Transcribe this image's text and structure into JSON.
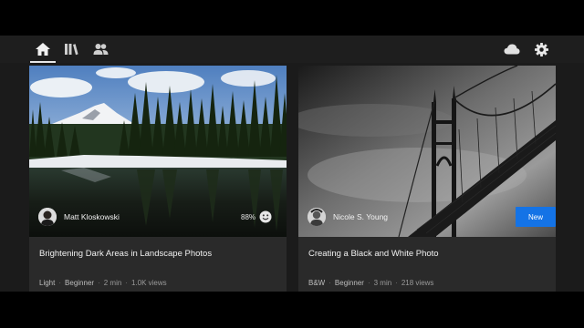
{
  "nav": {
    "items": [
      {
        "name": "home-icon",
        "active": true
      },
      {
        "name": "library-icon",
        "active": false
      },
      {
        "name": "people-icon",
        "active": false
      }
    ],
    "right": [
      "cloud-icon",
      "gear-icon"
    ]
  },
  "cards": [
    {
      "author": "Matt Kloskowski",
      "rating": "88%",
      "title": "Brightening Dark Areas in Landscape Photos",
      "meta": {
        "category": "Light",
        "level": "Beginner",
        "duration": "2 min",
        "views": "1.0K views"
      }
    },
    {
      "author": "Nicole S. Young",
      "badge": "New",
      "title": "Creating a Black and White Photo",
      "meta": {
        "category": "B&W",
        "level": "Beginner",
        "duration": "3 min",
        "views": "218 views"
      }
    }
  ],
  "colors": {
    "accent": "#1473e6",
    "background": "#1b1b1b",
    "card": "#2a2a2a"
  }
}
